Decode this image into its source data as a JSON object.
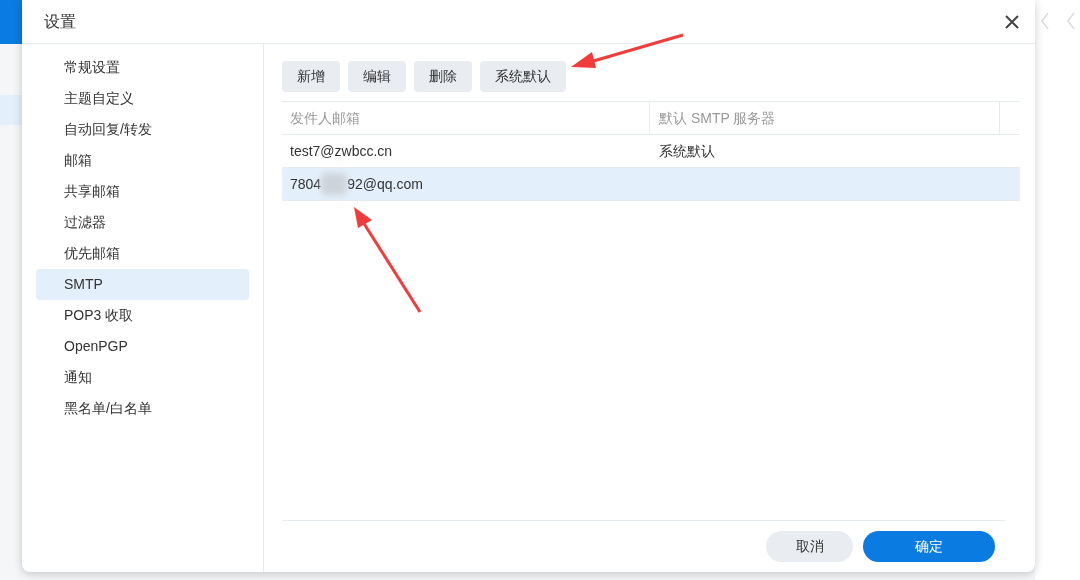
{
  "dialog": {
    "title": "设置"
  },
  "sidebar": {
    "items": [
      {
        "label": "常规设置",
        "selected": false
      },
      {
        "label": "主题自定义",
        "selected": false
      },
      {
        "label": "自动回复/转发",
        "selected": false
      },
      {
        "label": "邮箱",
        "selected": false
      },
      {
        "label": "共享邮箱",
        "selected": false
      },
      {
        "label": "过滤器",
        "selected": false
      },
      {
        "label": "优先邮箱",
        "selected": false
      },
      {
        "label": "SMTP",
        "selected": true
      },
      {
        "label": "POP3 收取",
        "selected": false
      },
      {
        "label": "OpenPGP",
        "selected": false
      },
      {
        "label": "通知",
        "selected": false
      },
      {
        "label": "黑名单/白名单",
        "selected": false
      }
    ]
  },
  "toolbar": {
    "buttons": [
      "新增",
      "编辑",
      "删除",
      "系统默认"
    ]
  },
  "table": {
    "columns": [
      "发件人邮箱",
      "默认 SMTP 服务器"
    ],
    "rows": [
      {
        "sender": "test7@zwbcc.cn",
        "smtp_server": "系统默认",
        "selected": false,
        "redacted": false
      },
      {
        "sender": "7804",
        "sender_after_blur": "92@qq.com",
        "selected": true,
        "redacted": true
      }
    ]
  },
  "footer": {
    "buttons": [
      {
        "label": "取消",
        "kind": "secondary"
      },
      {
        "label": "确定",
        "kind": "primary"
      }
    ]
  }
}
